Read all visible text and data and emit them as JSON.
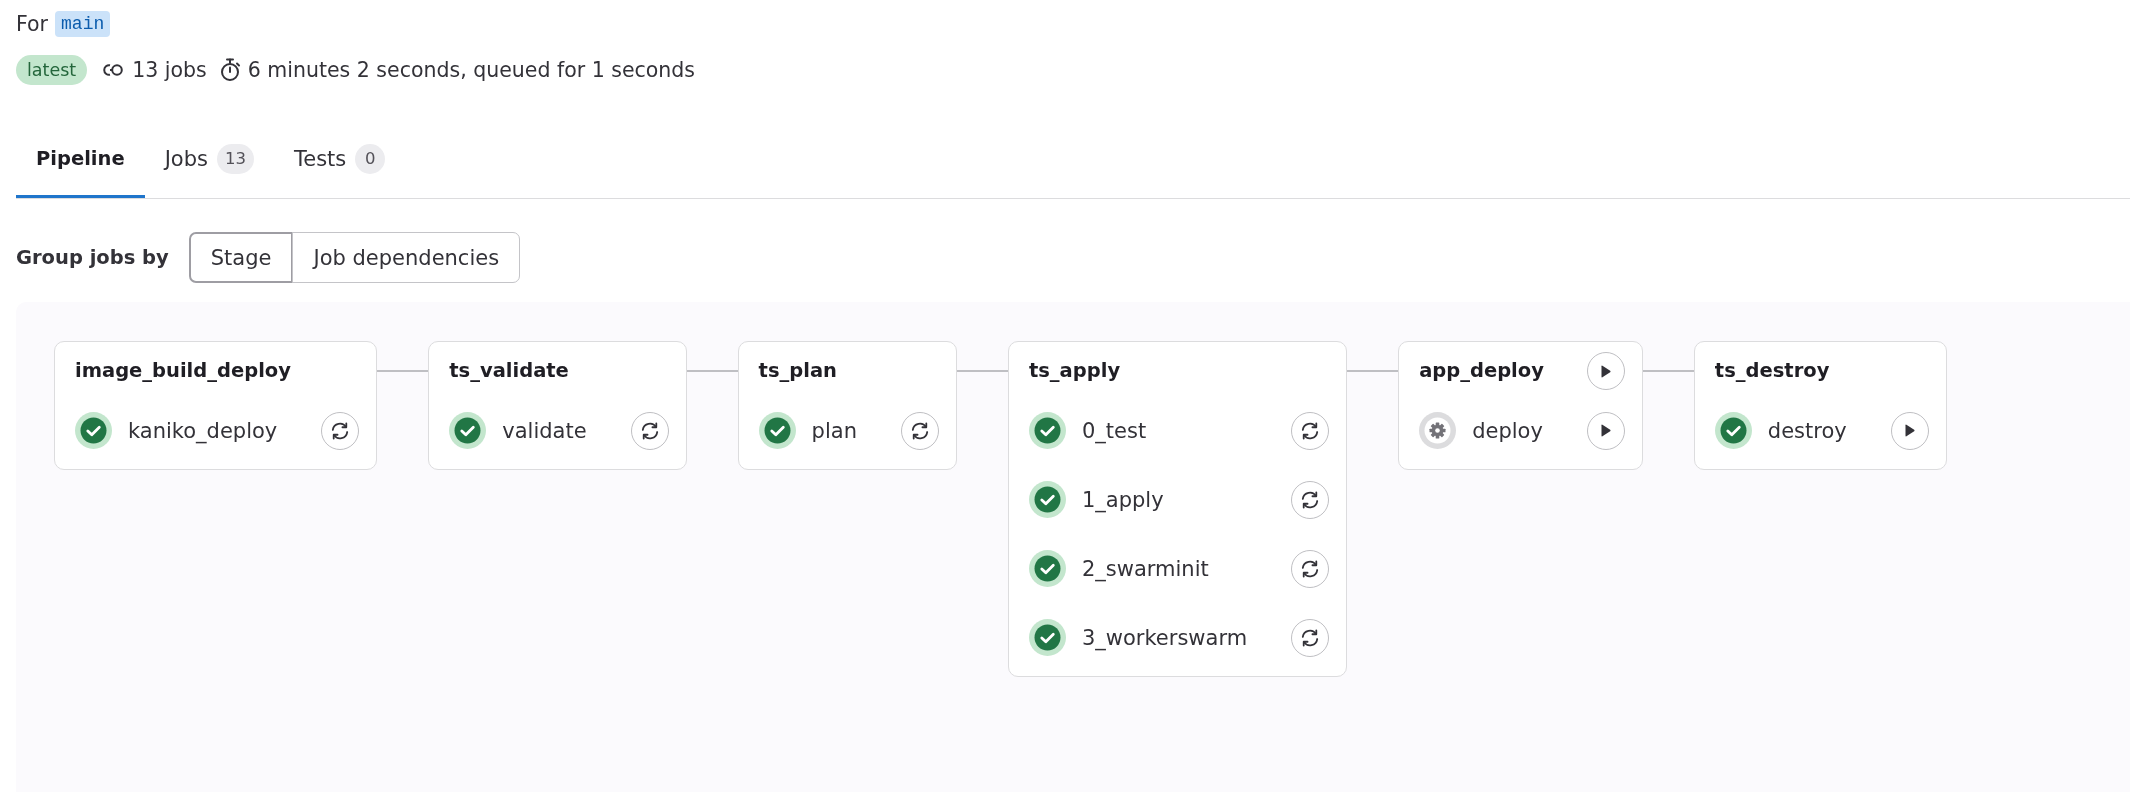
{
  "header": {
    "prefix": "For",
    "branch": "main"
  },
  "summary": {
    "badge": "latest",
    "jobs": "13 jobs",
    "duration": "6 minutes 2 seconds, queued for 1 seconds"
  },
  "tabs": [
    {
      "label": "Pipeline",
      "selected": true
    },
    {
      "label": "Jobs",
      "count": "13",
      "selected": false
    },
    {
      "label": "Tests",
      "count": "0",
      "selected": false
    }
  ],
  "group_by": {
    "label": "Group jobs by",
    "options": [
      {
        "label": "Stage",
        "selected": true
      },
      {
        "label": "Job dependencies",
        "selected": false
      }
    ]
  },
  "stages": [
    {
      "name": "image_build_deploy",
      "jobs": [
        {
          "name": "kaniko_deploy",
          "kind": "success",
          "button": {
            "kind": "retry"
          }
        }
      ]
    },
    {
      "name": "ts_validate",
      "jobs": [
        {
          "name": "validate",
          "kind": "success",
          "button": {
            "kind": "retry"
          }
        }
      ]
    },
    {
      "name": "ts_plan",
      "jobs": [
        {
          "name": "plan",
          "kind": "success",
          "button": {
            "kind": "retry"
          }
        }
      ]
    },
    {
      "name": "ts_apply",
      "jobs": [
        {
          "name": "0_test",
          "kind": "success",
          "button": {
            "kind": "retry"
          }
        },
        {
          "name": "1_apply",
          "kind": "success",
          "button": {
            "kind": "retry"
          }
        },
        {
          "name": "2_swarminit",
          "kind": "success",
          "button": {
            "kind": "retry"
          }
        },
        {
          "name": "3_workerswarm",
          "kind": "success",
          "button": {
            "kind": "retry"
          }
        }
      ]
    },
    {
      "name": "app_deploy",
      "button": {
        "kind": "play"
      },
      "jobs": [
        {
          "name": "deploy",
          "kind": "manual",
          "button": {
            "kind": "play"
          }
        }
      ]
    },
    {
      "name": "ts_destroy",
      "jobs": [
        {
          "name": "destroy",
          "kind": "success",
          "button": {
            "kind": "play"
          }
        }
      ]
    }
  ]
}
